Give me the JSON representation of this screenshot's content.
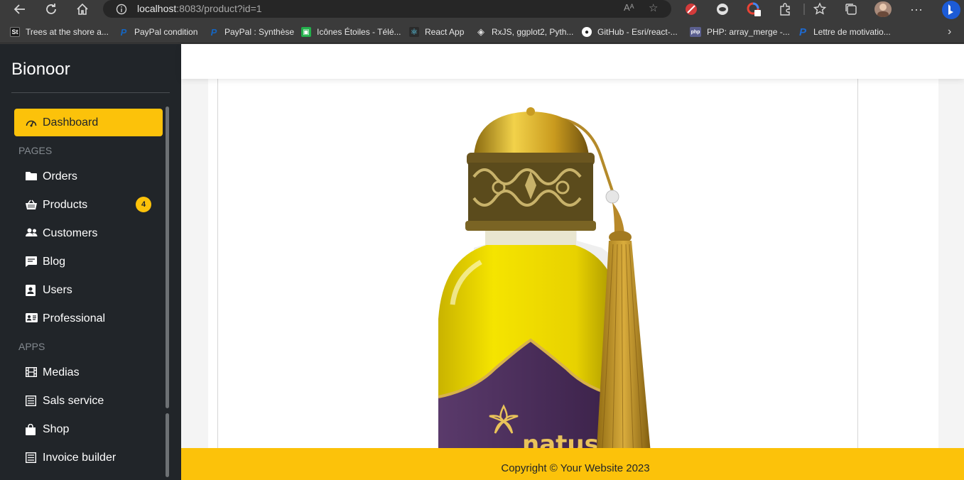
{
  "browser": {
    "url_host": "localhost",
    "url_rest": ":8083/product?id=1",
    "read_aloud": "Aᴬ",
    "bookmarks": [
      {
        "label": "Trees at the shore a...",
        "icon": "st-icon",
        "color": "#1a1a1a",
        "glyph": "St"
      },
      {
        "label": "PayPal condition",
        "icon": "paypal-icon",
        "color": "#0a3d91",
        "glyph": "P"
      },
      {
        "label": "PayPal : Synthèse",
        "icon": "paypal-icon",
        "color": "#0a3d91",
        "glyph": "P"
      },
      {
        "label": "Icônes Étoiles - Télé...",
        "icon": "flaticon-icon",
        "color": "#22b04b",
        "glyph": "▣"
      },
      {
        "label": "React App",
        "icon": "react-icon",
        "color": "#2b2b2b",
        "glyph": "⚛"
      },
      {
        "label": "RxJS, ggplot2, Pyth...",
        "icon": "rxjs-icon",
        "color": "#555555",
        "glyph": "◈"
      },
      {
        "label": "GitHub - Esri/react-...",
        "icon": "github-icon",
        "color": "#222222",
        "glyph": "●"
      },
      {
        "label": "PHP: array_merge -...",
        "icon": "php-icon",
        "color": "#5b5f8f",
        "glyph": "php"
      },
      {
        "label": "Lettre de motivatio...",
        "icon": "p-icon",
        "color": "#1e6ad1",
        "glyph": "P"
      }
    ]
  },
  "sidebar": {
    "brand": "Bionoor",
    "dashboard_label": "Dashboard",
    "section_pages": "PAGES",
    "section_apps": "APPS",
    "items": [
      {
        "label": "Orders",
        "icon": "folder-icon"
      },
      {
        "label": "Products",
        "icon": "basket-icon",
        "badge": "4"
      },
      {
        "label": "Customers",
        "icon": "users-icon"
      },
      {
        "label": "Blog",
        "icon": "comment-icon"
      },
      {
        "label": "Users",
        "icon": "id-badge-icon"
      },
      {
        "label": "Professional",
        "icon": "id-card-icon"
      },
      {
        "label": "Medias",
        "icon": "film-icon"
      },
      {
        "label": "Sals service",
        "icon": "list-icon"
      },
      {
        "label": "Shop",
        "icon": "shopping-bag-icon"
      },
      {
        "label": "Invoice builder",
        "icon": "list-icon"
      }
    ]
  },
  "product": {
    "brand_on_label": "natus",
    "image_icon": "oil-bottle-image"
  },
  "footer": {
    "text": "Copyright © Your Website 2023"
  },
  "colors": {
    "accent": "#fcc20a",
    "sidebar_bg": "#212529",
    "page_bg": "#f4f4f4"
  }
}
